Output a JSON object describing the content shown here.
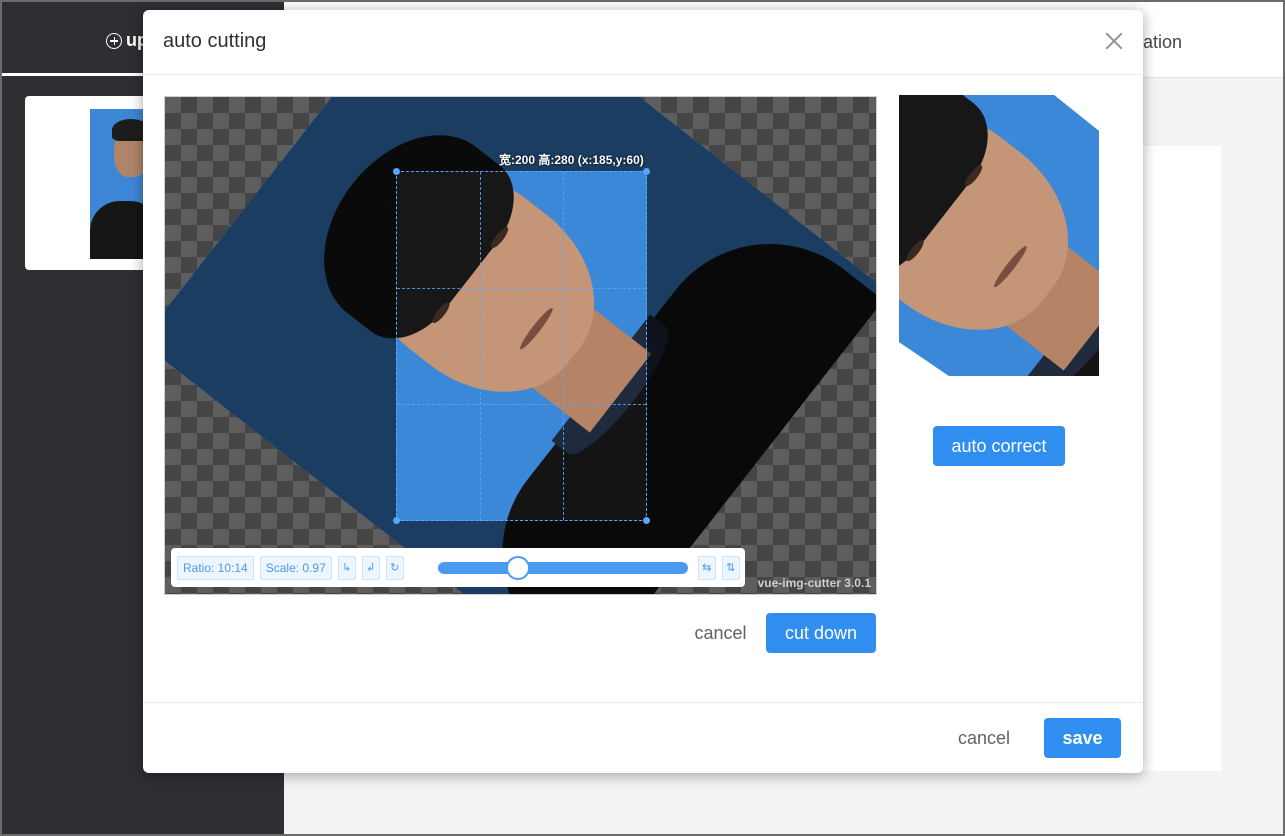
{
  "background": {
    "upload_label": "up",
    "top_right_text": "ation"
  },
  "dialog": {
    "title": "auto cutting",
    "close_icon": "close-icon"
  },
  "cutter": {
    "crop_info": "宽:200 高:280 (x:185,y:60)",
    "watermark": "vue-img-cutter 3.0.1",
    "ratio_label": "Ratio: 10:14",
    "scale_label": "Scale: 0.97",
    "rotate_left_icon": "↳",
    "rotate_right_icon": "↲",
    "reset_icon": "↻",
    "flip_horizontal_icon": "⇆",
    "flip_vertical_icon": "⇅",
    "slider_value": 0.3
  },
  "cutter_actions": {
    "cancel_label": "cancel",
    "cut_label": "cut down"
  },
  "preview": {
    "auto_correct_label": "auto correct"
  },
  "footer": {
    "cancel_label": "cancel",
    "save_label": "save"
  },
  "colors": {
    "primary": "#2f8ef0",
    "accent_line": "#58a6ff",
    "photo_background": "#3b87d8"
  }
}
